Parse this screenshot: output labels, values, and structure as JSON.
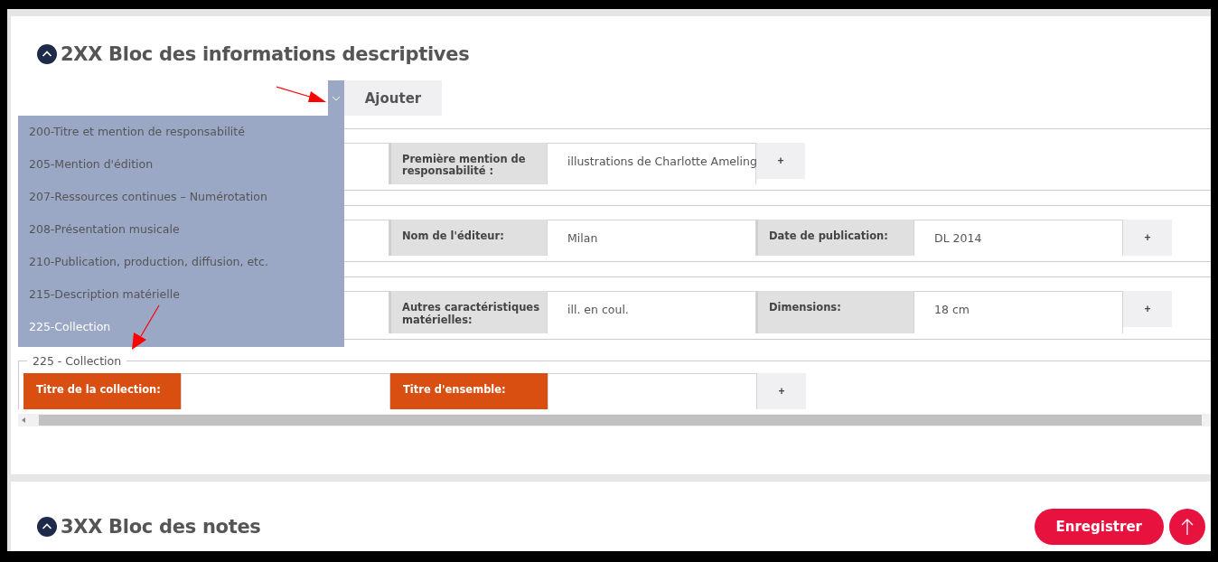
{
  "sections": [
    {
      "title": "2XX Bloc des informations descriptives"
    },
    {
      "title": "3XX Bloc des notes"
    }
  ],
  "add_button": "Ajouter",
  "dropdown": {
    "items": [
      {
        "label": "200-Titre et mention de responsabilité",
        "selected": false
      },
      {
        "label": "205-Mention d'édition",
        "selected": false
      },
      {
        "label": "207-Ressources continues – Numérotation",
        "selected": false
      },
      {
        "label": "208-Présentation musicale",
        "selected": false
      },
      {
        "label": "210-Publication, production, diffusion, etc.",
        "selected": false
      },
      {
        "label": "215-Description matérielle",
        "selected": false
      },
      {
        "label": "225-Collection",
        "selected": true
      }
    ]
  },
  "rows": [
    {
      "fields": [
        {
          "kind": "hidden"
        },
        {
          "kind": "text",
          "label": "Première mention de responsabilité :",
          "value": "illustrations de Charlotte Ameling",
          "highlighted": false
        }
      ],
      "add": "+"
    },
    {
      "fields": [
        {
          "kind": "hidden"
        },
        {
          "kind": "text",
          "label": "Nom de l'éditeur:",
          "value": "Milan",
          "highlighted": false
        },
        {
          "kind": "text",
          "label": "Date de publication:",
          "value": "DL 2014",
          "highlighted": false
        }
      ],
      "add": "+"
    },
    {
      "fields": [
        {
          "kind": "hidden"
        },
        {
          "kind": "text",
          "label": "Autres caractéristiques matérielles:",
          "value": "ill. en coul.",
          "highlighted": false
        },
        {
          "kind": "text",
          "label": "Dimensions:",
          "value": "18 cm",
          "highlighted": false
        }
      ],
      "add": "+"
    },
    {
      "legend": "225 - Collection",
      "fields": [
        {
          "kind": "text",
          "label": "Titre de la collection:",
          "highlighted": true
        },
        {
          "kind": "text",
          "label": "Titre d'ensemble:",
          "highlighted": true
        }
      ],
      "add": "+"
    }
  ],
  "save_button": "Enregistrer"
}
